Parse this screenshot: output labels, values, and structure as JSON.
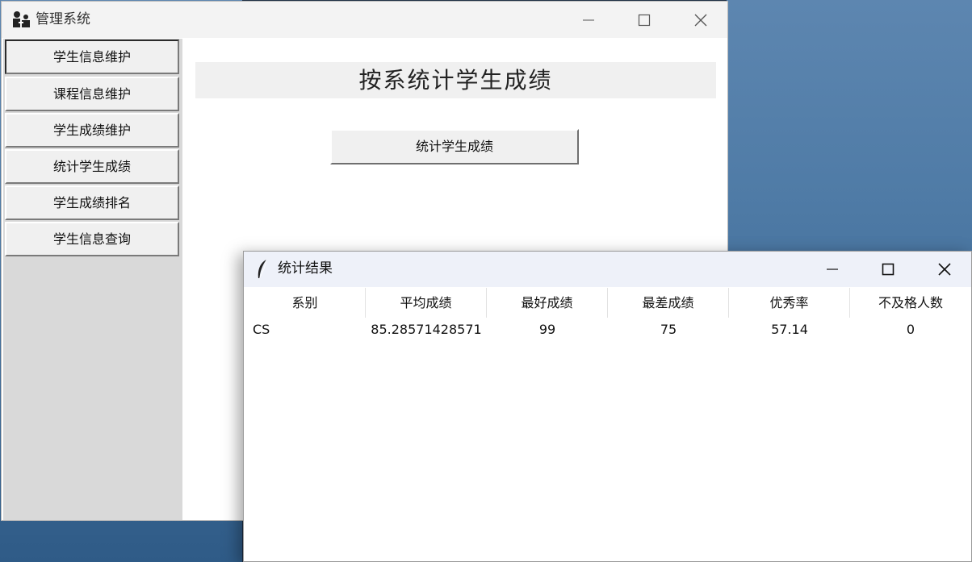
{
  "main_window": {
    "title": "管理系统",
    "sidebar": {
      "items": [
        {
          "label": "学生信息维护"
        },
        {
          "label": "课程信息维护"
        },
        {
          "label": "学生成绩维护"
        },
        {
          "label": "统计学生成绩"
        },
        {
          "label": "学生成绩排名"
        },
        {
          "label": "学生信息查询"
        }
      ]
    },
    "content": {
      "header": "按系统计学生成绩",
      "button_label": "统计学生成绩"
    }
  },
  "result_window": {
    "title": "统计结果",
    "columns": [
      "系别",
      "平均成绩",
      "最好成绩",
      "最差成绩",
      "优秀率",
      "不及格人数"
    ],
    "rows": [
      [
        "CS",
        "85.28571428571",
        "99",
        "75",
        "57.14",
        "0"
      ]
    ]
  },
  "icons": {
    "app": "app-icon",
    "minimize": "minimize-icon",
    "maximize": "maximize-icon",
    "close": "close-icon",
    "result_window": "feather-icon"
  },
  "colors": {
    "titlebar": "#f3f3f3",
    "sidebar_bg": "#d9d9d9",
    "button_bg": "#f0f0f0",
    "result_titlebar": "#eef1f9"
  }
}
